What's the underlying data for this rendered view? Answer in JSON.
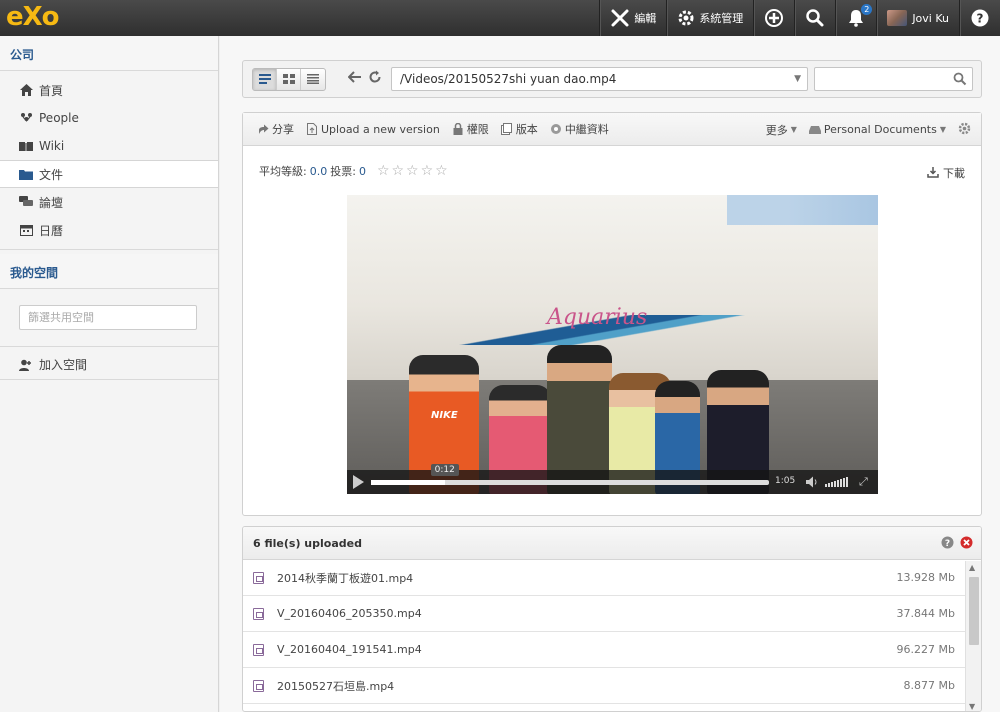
{
  "topbar": {
    "logo": "eXo",
    "edit_label": "編輯",
    "admin_label": "系統管理",
    "notification_count": "2",
    "user_name": "Jovi Ku",
    "icons": [
      "wrench-icon",
      "gear-icon",
      "plus-circle-icon",
      "search-icon",
      "bell-icon",
      "help-icon"
    ]
  },
  "sidebar": {
    "company_title": "公司",
    "items": [
      {
        "label": "首頁",
        "icon": "home-icon"
      },
      {
        "label": "People",
        "icon": "people-icon"
      },
      {
        "label": "Wiki",
        "icon": "book-icon"
      },
      {
        "label": "文件",
        "icon": "folder-icon"
      },
      {
        "label": "論壇",
        "icon": "chat-icon"
      },
      {
        "label": "日曆",
        "icon": "calendar-icon"
      }
    ],
    "spaces_title": "我的空間",
    "search_placeholder": "篩選共用空間",
    "join_label": "加入空間"
  },
  "addressbar": {
    "path": "/Videos/20150527shi yuan dao.mp4",
    "search_value": ""
  },
  "actions": {
    "share": "分享",
    "upload": "Upload a new version",
    "permissions": "權限",
    "versions": "版本",
    "metadata": "中繼資料",
    "more": "更多",
    "drive": "Personal Documents"
  },
  "rating": {
    "avg_label": "平均等級:",
    "avg_value": "0.0",
    "votes_label": "投票:",
    "votes_value": "0",
    "stars": "☆☆☆☆☆"
  },
  "download_label": "下載",
  "video": {
    "ship_name": "Aquarius",
    "shirt_text": "NIKE",
    "current_time": "0:12",
    "duration": "1:05",
    "progress": 0.185
  },
  "uploads": {
    "title": "6 file(s) uploaded",
    "files": [
      {
        "name": "2014秋季蘭丁板遊01.mp4",
        "size": "13.928 Mb"
      },
      {
        "name": "V_20160406_205350.mp4",
        "size": "37.844 Mb"
      },
      {
        "name": "V_20160404_191541.mp4",
        "size": "96.227 Mb"
      },
      {
        "name": "20150527石垣島.mp4",
        "size": "8.877 Mb"
      }
    ]
  }
}
